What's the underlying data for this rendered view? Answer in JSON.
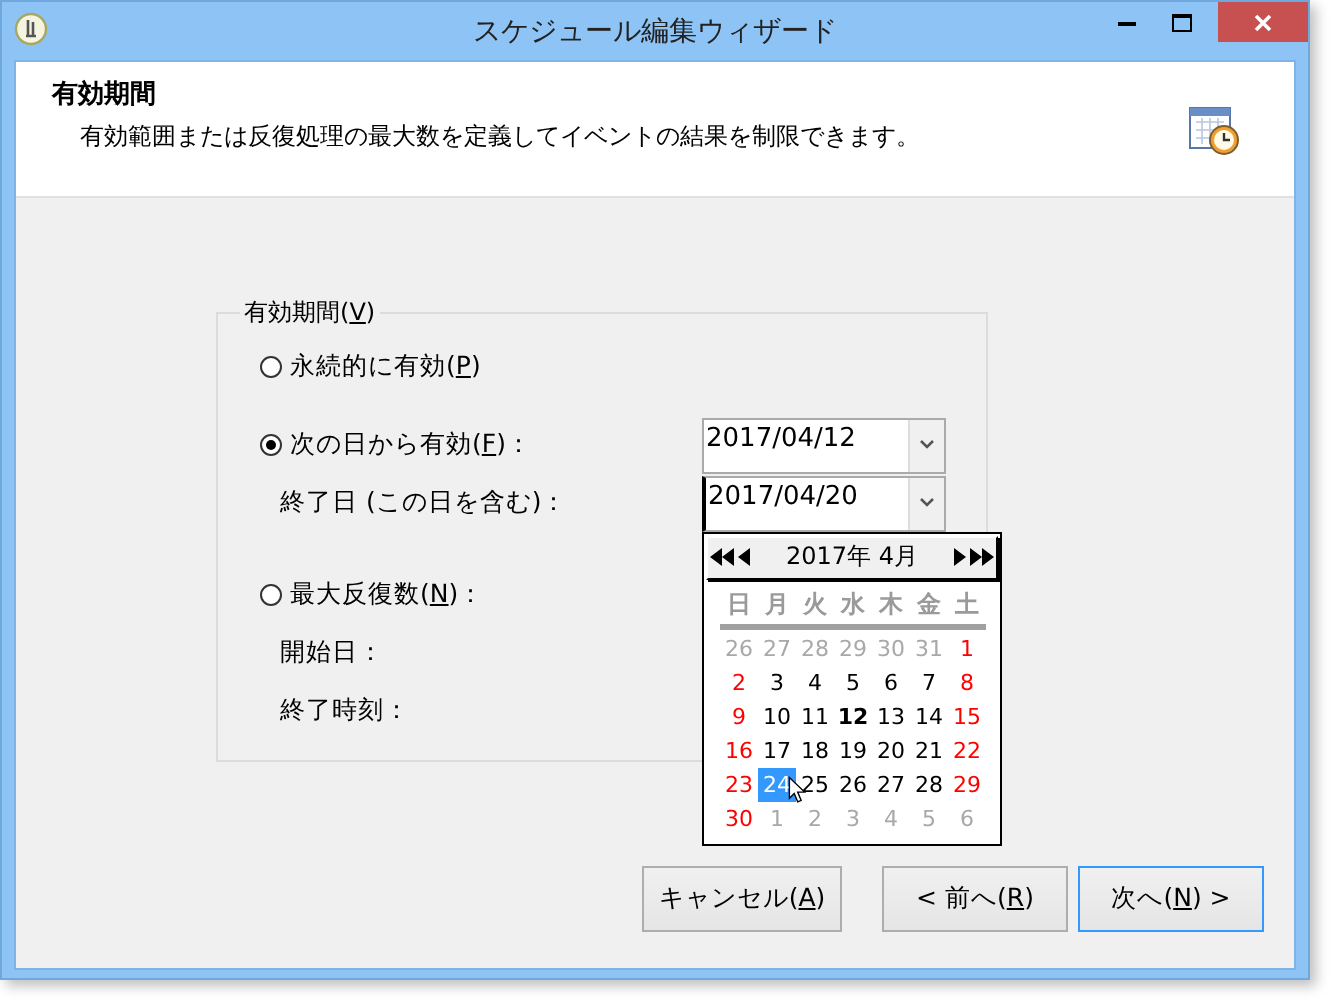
{
  "window": {
    "title": "スケジュール編集ウィザード"
  },
  "header": {
    "title": "有効期間",
    "description": "有効範囲または反復処理の最大数を定義してイベントの結果を制限できます。"
  },
  "group": {
    "label": "有効期間(",
    "access_key": "V",
    "label_end": ")"
  },
  "rows": [
    {
      "kind": "radio",
      "label": "永続的に有効(",
      "access_key": "P",
      "label_end": ")",
      "selected": false
    },
    {
      "kind": "radio",
      "label": "次の日から有効(",
      "access_key": "F",
      "label_end": ")：",
      "selected": true,
      "date_field": {
        "value": "2017/04/12"
      }
    },
    {
      "kind": "label",
      "label": "終了日 (この日を含む)：",
      "date_field": {
        "value": "2017/04/20",
        "focused": true,
        "open": true
      }
    },
    {
      "kind": "radio",
      "label": "最大反復数(",
      "access_key": "N",
      "label_end": ")：",
      "selected": false
    },
    {
      "kind": "label",
      "label": "開始日："
    },
    {
      "kind": "label",
      "label": "終了時刻："
    }
  ],
  "calendar": {
    "title": "2017年 4月",
    "weekdays": [
      "日",
      "月",
      "火",
      "水",
      "木",
      "金",
      "土"
    ],
    "weeks": [
      [
        {
          "day": "26",
          "kind": "outside",
          "selected": false
        },
        {
          "day": "27",
          "kind": "outside",
          "selected": false
        },
        {
          "day": "28",
          "kind": "outside",
          "selected": false
        },
        {
          "day": "29",
          "kind": "outside",
          "selected": false
        },
        {
          "day": "30",
          "kind": "outside",
          "selected": false
        },
        {
          "day": "31",
          "kind": "outside",
          "selected": false
        },
        {
          "day": "1",
          "kind": "holiday",
          "selected": false
        }
      ],
      [
        {
          "day": "2",
          "kind": "holiday",
          "selected": false
        },
        {
          "day": "3",
          "kind": "weekday",
          "selected": false
        },
        {
          "day": "4",
          "kind": "weekday",
          "selected": false
        },
        {
          "day": "5",
          "kind": "weekday",
          "selected": false
        },
        {
          "day": "6",
          "kind": "weekday",
          "selected": false
        },
        {
          "day": "7",
          "kind": "weekday",
          "selected": false
        },
        {
          "day": "8",
          "kind": "holiday",
          "selected": false
        }
      ],
      [
        {
          "day": "9",
          "kind": "holiday",
          "selected": false
        },
        {
          "day": "10",
          "kind": "weekday",
          "selected": false
        },
        {
          "day": "11",
          "kind": "weekday",
          "selected": false
        },
        {
          "day": "12",
          "kind": "today",
          "selected": false
        },
        {
          "day": "13",
          "kind": "weekday",
          "selected": false
        },
        {
          "day": "14",
          "kind": "weekday",
          "selected": false
        },
        {
          "day": "15",
          "kind": "holiday",
          "selected": false
        }
      ],
      [
        {
          "day": "16",
          "kind": "holiday",
          "selected": false
        },
        {
          "day": "17",
          "kind": "weekday",
          "selected": false
        },
        {
          "day": "18",
          "kind": "weekday",
          "selected": false
        },
        {
          "day": "19",
          "kind": "weekday",
          "selected": false
        },
        {
          "day": "20",
          "kind": "weekday",
          "selected": false
        },
        {
          "day": "21",
          "kind": "weekday",
          "selected": false
        },
        {
          "day": "22",
          "kind": "holiday",
          "selected": false
        }
      ],
      [
        {
          "day": "23",
          "kind": "holiday",
          "selected": false
        },
        {
          "day": "24",
          "kind": "weekday",
          "selected": true
        },
        {
          "day": "25",
          "kind": "weekday",
          "selected": false
        },
        {
          "day": "26",
          "kind": "weekday",
          "selected": false
        },
        {
          "day": "27",
          "kind": "weekday",
          "selected": false
        },
        {
          "day": "28",
          "kind": "weekday",
          "selected": false
        },
        {
          "day": "29",
          "kind": "holiday",
          "selected": false
        }
      ],
      [
        {
          "day": "30",
          "kind": "holiday",
          "selected": false
        },
        {
          "day": "1",
          "kind": "outside",
          "selected": false
        },
        {
          "day": "2",
          "kind": "outside",
          "selected": false
        },
        {
          "day": "3",
          "kind": "outside",
          "selected": false
        },
        {
          "day": "4",
          "kind": "outside",
          "selected": false
        },
        {
          "day": "5",
          "kind": "outside",
          "selected": false
        },
        {
          "day": "6",
          "kind": "outside",
          "selected": false
        }
      ]
    ]
  },
  "buttons": [
    {
      "label": "キャンセル(",
      "access_key": "A",
      "label_end": ")",
      "default": false
    },
    {
      "label": "< 前へ(",
      "access_key": "R",
      "label_end": ")",
      "default": false
    },
    {
      "label": "次へ(",
      "access_key": "N",
      "label_end": ") >",
      "default": true
    }
  ]
}
